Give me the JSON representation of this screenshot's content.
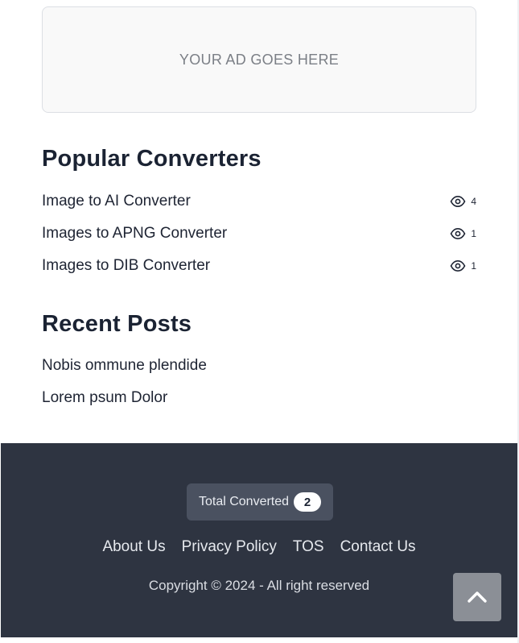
{
  "ad": {
    "text": "YOUR AD GOES HERE"
  },
  "popular": {
    "title": "Popular Converters",
    "items": [
      {
        "name": "Image to AI Converter",
        "views": "4"
      },
      {
        "name": "Images to APNG Converter",
        "views": "1"
      },
      {
        "name": "Images to DIB Converter",
        "views": "1"
      }
    ],
    "icon": "eye-icon"
  },
  "recent": {
    "title": "Recent Posts",
    "items": [
      {
        "title": "Nobis ommune plendide"
      },
      {
        "title": "Lorem psum Dolor"
      }
    ]
  },
  "footer": {
    "total_label": "Total Converted",
    "total_count": "2",
    "links": [
      "About Us",
      "Privacy Policy",
      "TOS",
      "Contact Us"
    ],
    "copyright": "Copyright © 2024 - All right reserved",
    "bg_color": "#2e3441"
  },
  "scroll_top": {
    "icon": "chevron-up-icon"
  }
}
